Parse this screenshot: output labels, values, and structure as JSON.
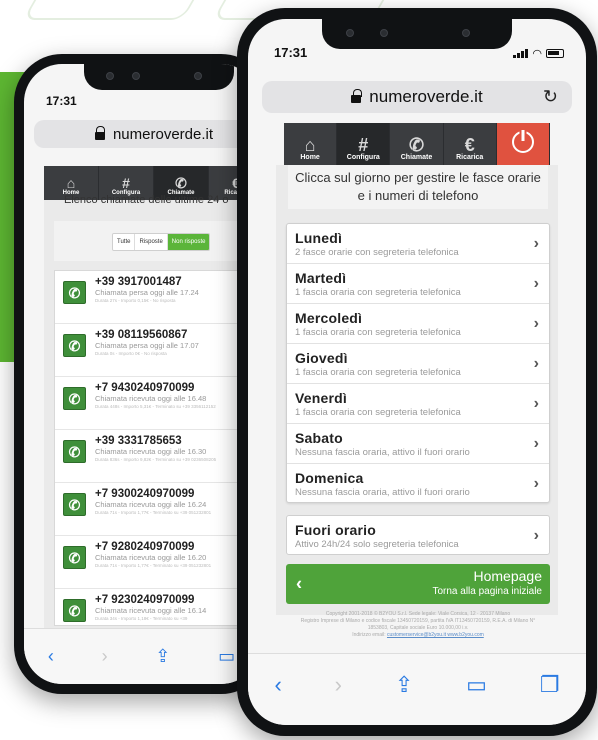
{
  "phone_front": {
    "status_time": "17:31",
    "url": "numeroverde.it",
    "reload_icon": "reload-icon",
    "nav": [
      {
        "label": "Home",
        "icon": "home-icon",
        "glyph": "⌂"
      },
      {
        "label": "Configura",
        "icon": "hash-icon",
        "glyph": "#"
      },
      {
        "label": "Chiamate",
        "icon": "phone-icon",
        "glyph": "✆"
      },
      {
        "label": "Ricarica",
        "icon": "euro-icon",
        "glyph": "€"
      }
    ],
    "power_icon": "power-icon",
    "instructions_line1": "Clicca sul giorno per gestire le fasce orarie",
    "instructions_line2": "e i numeri di telefono",
    "days": [
      {
        "name": "Lunedì",
        "sub": "2 fasce orarie con segreteria telefonica"
      },
      {
        "name": "Martedì",
        "sub": "1 fascia oraria con segreteria telefonica"
      },
      {
        "name": "Mercoledì",
        "sub": "1 fascia oraria con segreteria telefonica"
      },
      {
        "name": "Giovedì",
        "sub": "1 fascia oraria con segreteria telefonica"
      },
      {
        "name": "Venerdì",
        "sub": "1 fascia oraria con segreteria telefonica"
      },
      {
        "name": "Sabato",
        "sub": "Nessuna fascia oraria, attivo il fuori orario"
      },
      {
        "name": "Domenica",
        "sub": "Nessuna fascia oraria, attivo il fuori orario"
      }
    ],
    "outside_hours": {
      "name": "Fuori orario",
      "sub": "Attivo 24h/24 solo segreteria telefonica"
    },
    "homepage_button": {
      "title": "Homepage",
      "subtitle": "Torna alla pagina iniziale"
    },
    "footer_line1": "Copyright 2001-2018 © B2YOU S.r.l. Sede legale: Viale Corsica, 12 · 20137 Milano",
    "footer_line2": "Registro Imprese di Milano e codice fiscale 13450720159, partita IVA IT13450720159, R.E.A. di Milano N°",
    "footer_line3": "1853803, Capitale sociale Euro 10.000,00 i.v.",
    "footer_line4_prefix": "Indirizzo email:",
    "footer_links": "customerservice@b2you.it  www.b2you.com",
    "toolbar": [
      "back-icon",
      "forward-icon",
      "share-icon",
      "bookmarks-icon",
      "tabs-icon"
    ]
  },
  "phone_back": {
    "status_time": "17:31",
    "url": "numeroverde.it",
    "nav": [
      {
        "label": "Home",
        "glyph": "⌂"
      },
      {
        "label": "Configura",
        "glyph": "#"
      },
      {
        "label": "Chiamate",
        "glyph": "✆"
      },
      {
        "label": "Ricarica",
        "glyph": "€"
      }
    ],
    "list_title": "Elenco chiamate delle ultime 24 o",
    "filters": [
      "Tutte",
      "Risposte",
      "Non risposte"
    ],
    "calls": [
      {
        "number": "+39 3917001487",
        "status": "Chiamata persa oggi alle 17.24",
        "detail": "Durata 27s - Importo 0,15€ - No risposta"
      },
      {
        "number": "+39 08119560867",
        "status": "Chiamata persa oggi alle 17.07",
        "detail": "Durata 0s - Importo 0€ - No risposta"
      },
      {
        "number": "+7 9430240970099",
        "status": "Chiamata ricevuta oggi alle 16.48",
        "detail": "Durata 448s - Importo 5,31€ - Terminato su +39 3356112152"
      },
      {
        "number": "+39 3331785653",
        "status": "Chiamata ricevuta oggi alle 16.30",
        "detail": "Durata 836s - Importo 9,82€ - Terminato su +39 0236508205"
      },
      {
        "number": "+7 9300240970099",
        "status": "Chiamata ricevuta oggi alle 16.24",
        "detail": "Durata 71s - Importo 1,77€ - Terminato su +39 051232801"
      },
      {
        "number": "+7 9280240970099",
        "status": "Chiamata ricevuta oggi alle 16.20",
        "detail": "Durata 71s - Importo 1,77€ - Terminato su +39 051232801"
      },
      {
        "number": "+7 9230240970099",
        "status": "Chiamata ricevuta oggi alle 16.14",
        "detail": "Durata 34s - Importo 1,18€ - Terminato su +39"
      }
    ]
  },
  "colors": {
    "accent_green": "#4fa33a",
    "nav_dark": "#3b3d40",
    "power_red": "#e0523f",
    "ios_blue": "#2a7ae2"
  }
}
